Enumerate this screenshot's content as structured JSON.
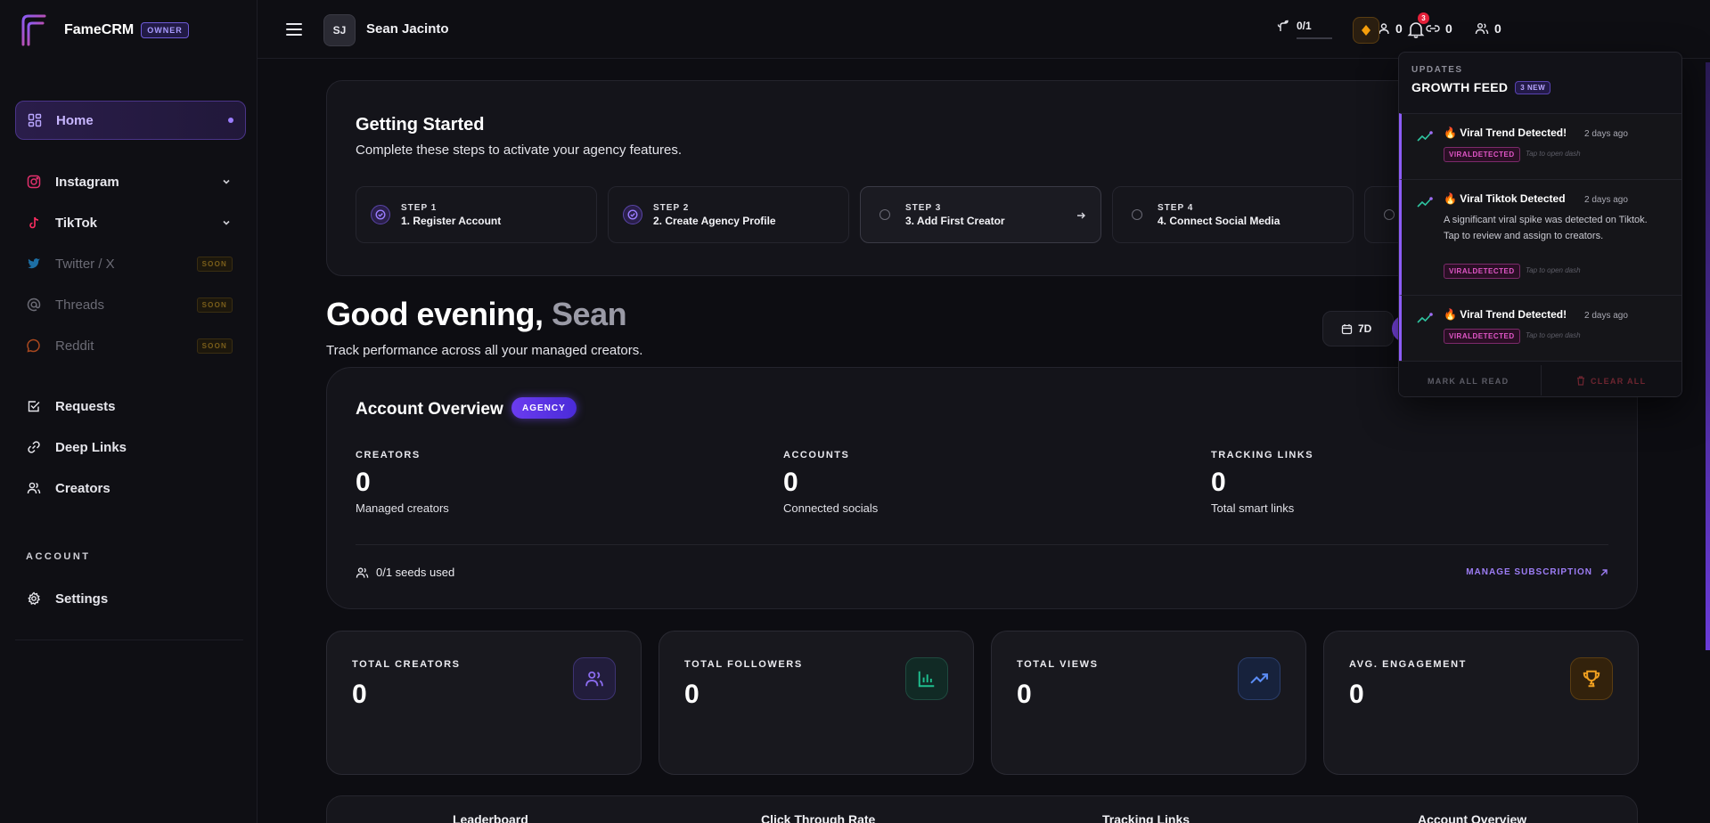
{
  "brand": {
    "name": "FameCRM",
    "role_badge": "OWNER"
  },
  "sidebar": {
    "items": [
      {
        "id": "home",
        "label": "Home",
        "icon": "grid-icon",
        "active": true
      },
      {
        "id": "instagram",
        "label": "Instagram",
        "icon": "instagram-icon",
        "expandable": true
      },
      {
        "id": "tiktok",
        "label": "TikTok",
        "icon": "tiktok-icon",
        "expandable": true
      },
      {
        "id": "twitter",
        "label": "Twitter / X",
        "icon": "twitter-icon",
        "badge": "SOON"
      },
      {
        "id": "threads",
        "label": "Threads",
        "icon": "threads-icon",
        "badge": "SOON"
      },
      {
        "id": "reddit",
        "label": "Reddit",
        "icon": "reddit-icon",
        "badge": "SOON"
      },
      {
        "id": "requests",
        "label": "Requests",
        "icon": "checkbox-icon"
      },
      {
        "id": "deep-links",
        "label": "Deep Links",
        "icon": "link-icon"
      },
      {
        "id": "creators",
        "label": "Creators",
        "icon": "users-icon"
      }
    ],
    "account_section": "ACCOUNT",
    "settings_label": "Settings"
  },
  "topbar": {
    "avatar_initials": "SJ",
    "user_name": "Sean Jacinto",
    "stats": {
      "creators": "0",
      "links": "0",
      "accounts": "0"
    },
    "seeds": "0/1",
    "notification_count": "3"
  },
  "getting_started": {
    "title": "Getting Started",
    "subtitle": "Complete these steps to activate your agency features.",
    "steps": [
      {
        "step": "STEP 1",
        "label": "1. Register Account",
        "status": "done"
      },
      {
        "step": "STEP 2",
        "label": "2. Create Agency Profile",
        "status": "done"
      },
      {
        "step": "STEP 3",
        "label": "3. Add First Creator",
        "status": "current"
      },
      {
        "step": "STEP 4",
        "label": "4. Connect Social Media",
        "status": "todo"
      }
    ]
  },
  "greeting": {
    "prefix": "Good evening,",
    "name": "Sean",
    "subtitle": "Track performance across all your managed creators.",
    "range_label": "7D"
  },
  "account_overview": {
    "title": "Account Overview",
    "badge": "AGENCY",
    "metrics": [
      {
        "label": "CREATORS",
        "value": "0",
        "desc": "Managed creators"
      },
      {
        "label": "ACCOUNTS",
        "value": "0",
        "desc": "Connected socials"
      },
      {
        "label": "TRACKING LINKS",
        "value": "0",
        "desc": "Total smart links"
      }
    ],
    "seeds_used": "0/1 seeds used",
    "manage_label": "MANAGE SUBSCRIPTION"
  },
  "kpis": [
    {
      "label": "TOTAL CREATORS",
      "value": "0",
      "icon": "users-icon",
      "color": "#8b6cf0"
    },
    {
      "label": "TOTAL FOLLOWERS",
      "value": "0",
      "icon": "bar-chart-icon",
      "color": "#1fbf8f"
    },
    {
      "label": "TOTAL VIEWS",
      "value": "0",
      "icon": "trending-up-icon",
      "color": "#5b8cf5"
    },
    {
      "label": "AVG. ENGAGEMENT",
      "value": "0",
      "icon": "trophy-icon",
      "color": "#f0a020"
    }
  ],
  "bottom_tabs": [
    "Leaderboard",
    "Click Through Rate",
    "Tracking Links",
    "Account Overview"
  ],
  "notifications": {
    "kicker": "UPDATES",
    "title": "GROWTH FEED",
    "new_badge": "3 NEW",
    "items": [
      {
        "title": "Viral Trend Detected!",
        "time": "2 days ago",
        "body": "",
        "tag": "VIRALDETECTED",
        "hint": "Tap to open dash"
      },
      {
        "title": "Viral Tiktok Detected",
        "time": "2 days ago",
        "body": "A significant viral spike was detected on Tiktok. Tap to review and assign to creators.",
        "tag": "VIRALDETECTED",
        "hint": "Tap to open dash"
      },
      {
        "title": "Viral Trend Detected!",
        "time": "2 days ago",
        "body": "",
        "tag": "VIRALDETECTED",
        "hint": "Tap to open dash"
      }
    ],
    "mark_all_read": "MARK ALL READ",
    "clear_all": "CLEAR ALL"
  }
}
